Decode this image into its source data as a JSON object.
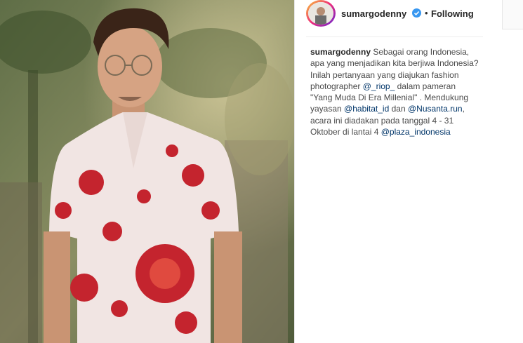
{
  "post": {
    "username": "sumargodenny",
    "separator": "•",
    "follow_status": "Following",
    "caption": {
      "author": "sumargodenny",
      "text_1": "Sebagai orang Indonesia, apa yang menjadikan kita berjiwa Indonesia? Inilah pertanyaan yang diajukan fashion photographer",
      "mention_1": "@_riop_",
      "text_2": "dalam pameran \"Yang Muda Di Era Millenial\" . Mendukung yayasan",
      "mention_2": "@habitat_id",
      "text_3": "dan",
      "mention_3": "@Nusanta.run",
      "text_4": ", acara ini diadakan pada tanggal 4 - 31 Oktober di lantai 4",
      "mention_4": "@plaza_indonesia"
    }
  },
  "icons": {
    "avatar": "profile-avatar",
    "verified": "verified-badge-icon"
  },
  "colors": {
    "verified_blue": "#3897f0",
    "mention_blue": "#003569",
    "text_dark": "#262626",
    "shirt_red": "#c4242e"
  }
}
